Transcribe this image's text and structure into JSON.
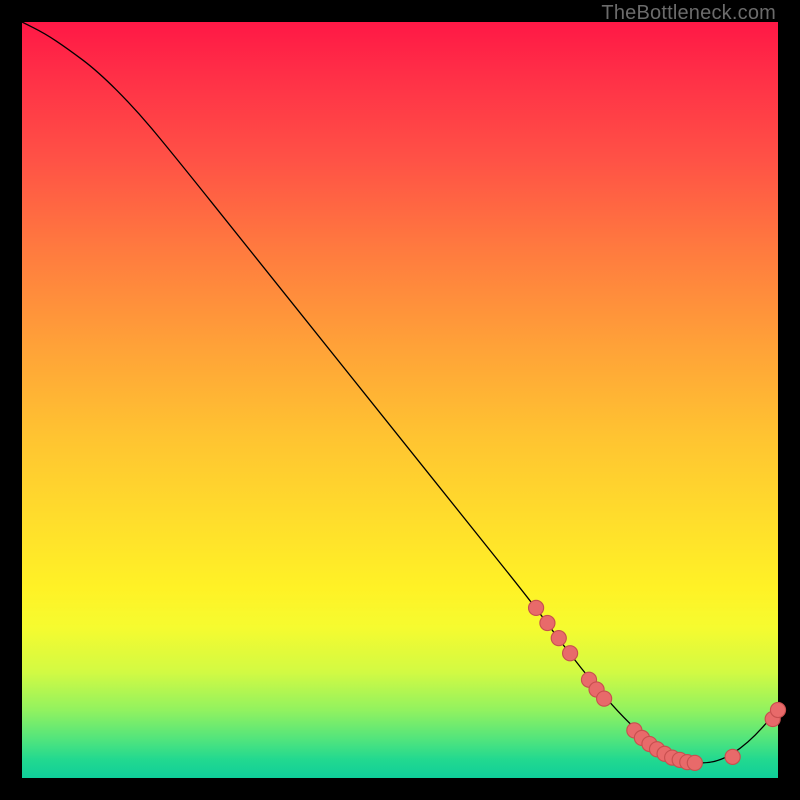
{
  "watermark": "TheBottleneck.com",
  "colors": {
    "curve_stroke": "#000000",
    "marker_fill": "#e86a6a",
    "marker_stroke": "#c84f4f"
  },
  "chart_data": {
    "type": "line",
    "title": "",
    "xlabel": "",
    "ylabel": "",
    "xlim": [
      0,
      100
    ],
    "ylim": [
      0,
      100
    ],
    "grid": false,
    "legend": false,
    "series": [
      {
        "name": "curve",
        "x": [
          0,
          3,
          6,
          10,
          15,
          20,
          30,
          40,
          50,
          60,
          68,
          72,
          76,
          80,
          84,
          88,
          92,
          96,
          100
        ],
        "y": [
          100,
          98.5,
          96.5,
          93.5,
          88.5,
          82.5,
          70,
          57.5,
          45,
          32.5,
          22.5,
          17,
          12,
          7.5,
          4,
          2,
          2,
          4.5,
          9
        ]
      }
    ],
    "markers": [
      {
        "name": "cluster-upper",
        "points": [
          {
            "x": 68,
            "y": 22.5
          },
          {
            "x": 69.5,
            "y": 20.5
          },
          {
            "x": 71,
            "y": 18.5
          },
          {
            "x": 72.5,
            "y": 16.5
          }
        ]
      },
      {
        "name": "cluster-mid",
        "points": [
          {
            "x": 75,
            "y": 13
          },
          {
            "x": 76,
            "y": 11.7
          },
          {
            "x": 77,
            "y": 10.5
          }
        ]
      },
      {
        "name": "cluster-bottom",
        "points": [
          {
            "x": 81,
            "y": 6.3
          },
          {
            "x": 82,
            "y": 5.3
          },
          {
            "x": 83,
            "y": 4.5
          },
          {
            "x": 84,
            "y": 3.8
          },
          {
            "x": 85,
            "y": 3.2
          },
          {
            "x": 86,
            "y": 2.7
          },
          {
            "x": 87,
            "y": 2.4
          },
          {
            "x": 88,
            "y": 2.1
          },
          {
            "x": 89,
            "y": 2.0
          }
        ]
      },
      {
        "name": "cluster-right",
        "points": [
          {
            "x": 94,
            "y": 2.8
          },
          {
            "x": 99.3,
            "y": 7.8
          },
          {
            "x": 100,
            "y": 9
          }
        ]
      }
    ]
  }
}
